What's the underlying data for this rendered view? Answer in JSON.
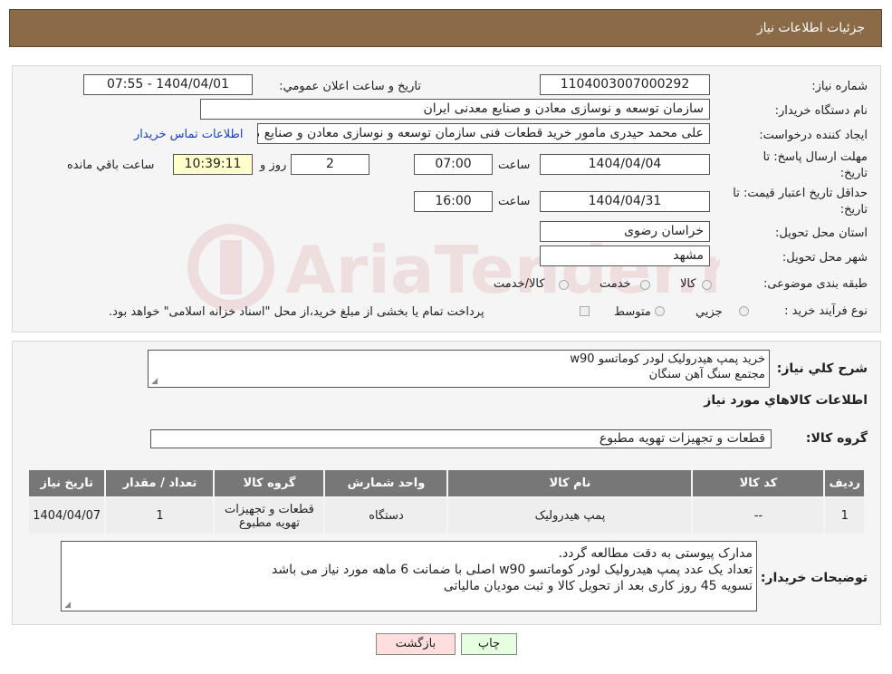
{
  "header": {
    "title": "جزئیات اطلاعات نیاز"
  },
  "form": {
    "need_number_label": "شماره نیاز:",
    "need_number": "1104003007000292",
    "announce_label": "تاریخ و ساعت اعلان عمومي:",
    "announce_value": "1404/04/01 - 07:55",
    "buyer_org_label": "نام دستگاه خريدار:",
    "buyer_org": "سازمان توسعه و نوسازی معادن و صنایع معدنی ایران",
    "creator_label": "ايجاد کننده درخواست:",
    "creator": "علی محمد حیدری مامور خرید قطعات فنی سازمان توسعه و نوسازی معادن و صنایع معدنی ایران",
    "contact_link": "اطلاعات تماس خريدار",
    "deadline_label": "مهلت ارسال پاسخ: تا تاريخ:",
    "deadline_date": "1404/04/04",
    "time_label": "ساعت",
    "deadline_time": "07:00",
    "days_value": "2",
    "days_label": "روز و",
    "remaining_time": "10:39:11",
    "remaining_label": "ساعت باقي مانده",
    "validity_label": "حداقل تاريخ اعتبار قيمت: تا تاريخ:",
    "validity_date": "1404/04/31",
    "validity_time": "16:00",
    "province_label": "استان محل تحويل:",
    "province": "خراسان رضوی",
    "city_label": "شهر محل تحويل:",
    "city": "مشهد",
    "category_label": "طبقه بندی موضوعی:",
    "category_options": [
      "کالا",
      "خدمت",
      "کالا/خدمت"
    ],
    "purchase_type_label": "نوع فرآيند خريد :",
    "purchase_options": [
      "جزيي",
      "متوسط"
    ],
    "purchase_note": "پرداخت تمام يا بخشی از مبلغ خريد،از محل \"اسناد خزانه اسلامی\" خواهد بود."
  },
  "details": {
    "summary_label": "شرح کلي نياز:",
    "summary_line1": "خرید پمپ هیدرولیک لودر کوماتسو w90",
    "summary_line2": "مجتمع سنگ آهن سنگان",
    "goods_info_title": "اطلاعات کالاهاي مورد نياز",
    "goods_group_label": "گروه کالا:",
    "goods_group": "قطعات و تجهیزات تهویه مطبوع",
    "table": {
      "headers": [
        "رديف",
        "کد کالا",
        "نام کالا",
        "واحد شمارش",
        "گروه کالا",
        "تعداد / مقدار",
        "تاريخ نياز"
      ],
      "rows": [
        [
          "1",
          "--",
          "پمپ هیدرولیک",
          "دستگاه",
          "قطعات و تجهیزات تهویه مطبوع",
          "1",
          "1404/04/07"
        ]
      ]
    },
    "buyer_notes_label": "توضيحات خريدار:",
    "buyer_notes_line1": "مدارک پیوستی به دقت مطالعه گردد.",
    "buyer_notes_line2": "تعداد یک عدد پمپ هیدرولیک لودر کوماتسو w90 اصلی با ضمانت 6 ماهه مورد نیاز می باشد",
    "buyer_notes_line3": "تسویه 45 روز کاری بعد از تحویل کالا و ثبت مودیان مالیاتی"
  },
  "buttons": {
    "print": "چاپ",
    "back": "بازگشت"
  },
  "colors": {
    "header_bg": "#8b6b47",
    "table_header_bg": "#777777",
    "link": "#1a3fcf",
    "back_button_bg": "#ffdede",
    "print_button_bg": "#e6ffe0"
  }
}
